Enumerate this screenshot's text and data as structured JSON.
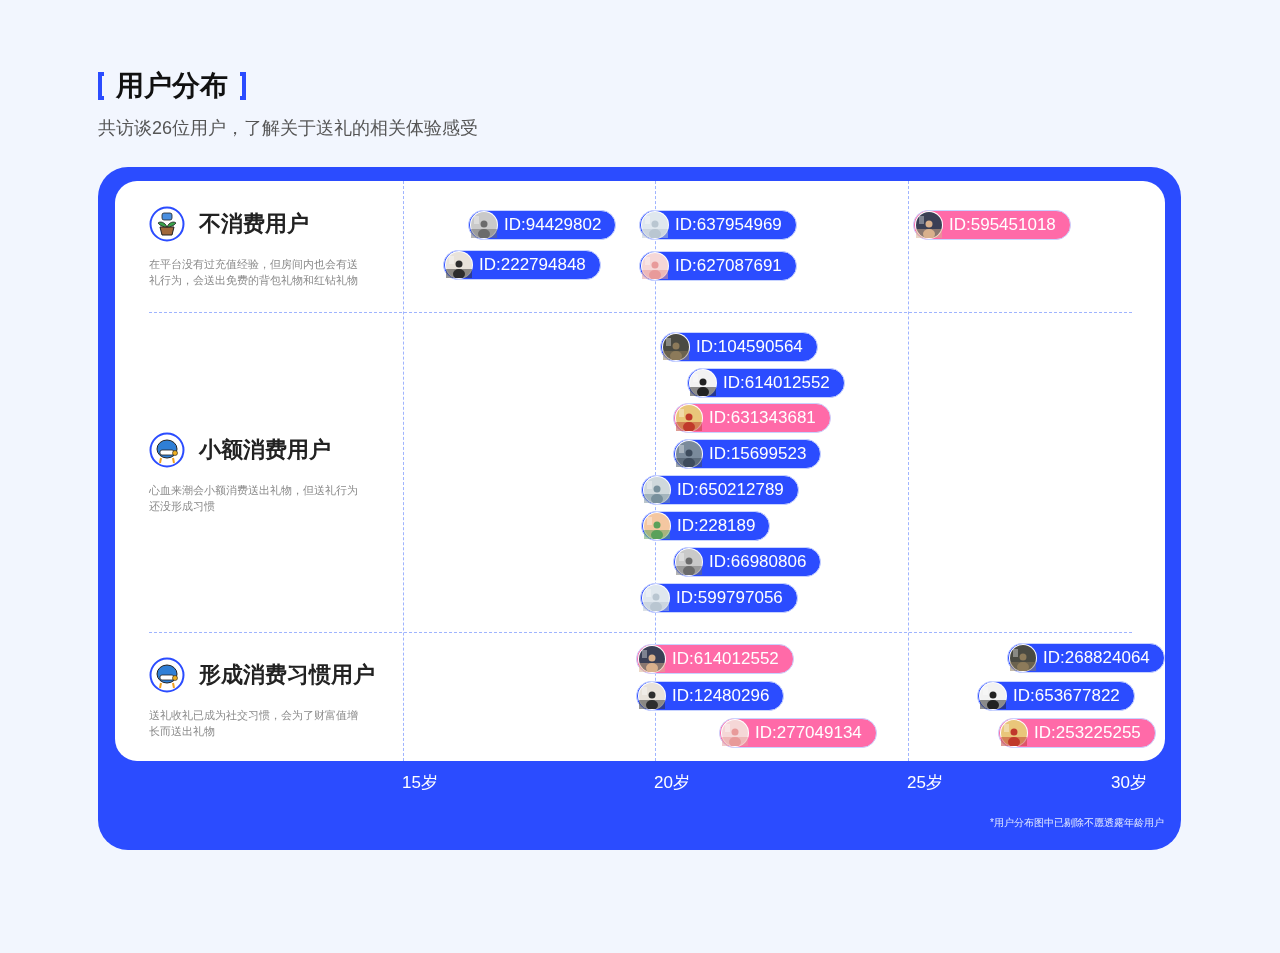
{
  "header": {
    "title": "用户分布",
    "subtitle": "共访谈26位用户，了解关于送礼的相关体验感受"
  },
  "segments": [
    {
      "kind": "plant",
      "title": "不消费用户",
      "description": "在平台没有过充值经验，但房间内也会有送礼行为，会送出免费的背包礼物和红钻礼物",
      "users": [
        {
          "id": "ID:94429802",
          "color": "#2b4cff"
        },
        {
          "id": "ID:637954969",
          "color": "#2b4cff"
        },
        {
          "id": "ID:595451018",
          "color": "#ff6aa8"
        },
        {
          "id": "ID:222794848",
          "color": "#2b4cff"
        },
        {
          "id": "ID:627087691",
          "color": "#2b4cff"
        }
      ]
    },
    {
      "kind": "mascot",
      "title": "小额消费用户",
      "description": "心血来潮会小额消费送出礼物，但送礼行为还没形成习惯",
      "users": [
        {
          "id": "ID:104590564",
          "color": "#2b4cff"
        },
        {
          "id": "ID:614012552",
          "color": "#2b4cff"
        },
        {
          "id": "ID:631343681",
          "color": "#ff6aa8"
        },
        {
          "id": "ID:15699523",
          "color": "#2b4cff"
        },
        {
          "id": "ID:650212789",
          "color": "#2b4cff"
        },
        {
          "id": "ID:228189",
          "color": "#2b4cff"
        },
        {
          "id": "ID:66980806",
          "color": "#2b4cff"
        },
        {
          "id": "ID:599797056",
          "color": "#2b4cff"
        }
      ]
    },
    {
      "kind": "mascot",
      "title": "形成消费习惯用户",
      "description": "送礼收礼已成为社交习惯，会为了财富值增长而送出礼物",
      "users": [
        {
          "id": "ID:614012552",
          "color": "#ff6aa8"
        },
        {
          "id": "ID:12480296",
          "color": "#2b4cff"
        },
        {
          "id": "ID:277049134",
          "color": "#ff6aa8"
        },
        {
          "id": "ID:268824064",
          "color": "#2b4cff"
        },
        {
          "id": "ID:653677822",
          "color": "#2b4cff"
        },
        {
          "id": "ID:253225255",
          "color": "#ff6aa8"
        }
      ]
    }
  ],
  "axis": {
    "ticks": [
      "15岁",
      "20岁",
      "25岁",
      "30岁"
    ]
  },
  "footnote": "*用户分布图中已剔除不愿透露年龄用户"
}
